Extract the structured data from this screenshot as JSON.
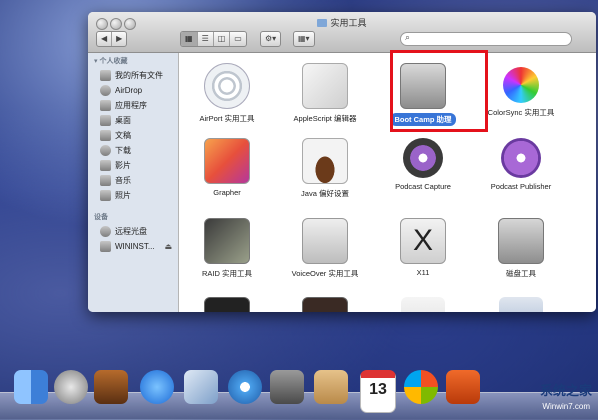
{
  "window": {
    "title": "实用工具",
    "nav": {
      "back": "◀",
      "forward": "▶"
    },
    "view_buttons": [
      "▦",
      "☰",
      "◫",
      "▭"
    ],
    "action_button": "⚙▾",
    "arrange_button": "▦▾",
    "search": {
      "icon": "search-icon",
      "placeholder": ""
    }
  },
  "sidebar": {
    "section_favorites": "个人收藏",
    "favorites": [
      {
        "label": "我的所有文件",
        "icon": "all-files-icon"
      },
      {
        "label": "AirDrop",
        "icon": "airdrop-icon"
      },
      {
        "label": "应用程序",
        "icon": "applications-icon"
      },
      {
        "label": "桌面",
        "icon": "desktop-icon"
      },
      {
        "label": "文稿",
        "icon": "documents-icon"
      },
      {
        "label": "下载",
        "icon": "downloads-icon"
      },
      {
        "label": "影片",
        "icon": "movies-icon"
      },
      {
        "label": "音乐",
        "icon": "music-icon"
      },
      {
        "label": "照片",
        "icon": "pictures-icon"
      }
    ],
    "section_devices": "设备",
    "devices": [
      {
        "label": "远程光盘",
        "icon": "remote-disc-icon"
      },
      {
        "label": "WININST...",
        "icon": "disk-icon",
        "eject": "⏏"
      }
    ]
  },
  "apps": [
    {
      "label": "AirPort 实用工具",
      "icon": "airport-utility-icon"
    },
    {
      "label": "AppleScript 编辑器",
      "icon": "applescript-editor-icon"
    },
    {
      "label": "Boot Camp 助理",
      "icon": "boot-camp-icon",
      "selected": true
    },
    {
      "label": "ColorSync 实用工具",
      "icon": "colorsync-icon"
    },
    {
      "label": "Grapher",
      "icon": "grapher-icon"
    },
    {
      "label": "Java 偏好设置",
      "icon": "java-icon"
    },
    {
      "label": "Podcast Capture",
      "icon": "podcast-capture-icon"
    },
    {
      "label": "Podcast Publisher",
      "icon": "podcast-publisher-icon"
    },
    {
      "label": "RAID 实用工具",
      "icon": "raid-utility-icon"
    },
    {
      "label": "VoiceOver 实用工具",
      "icon": "voiceover-icon"
    },
    {
      "label": "X11",
      "icon": "x11-icon"
    },
    {
      "label": "磁盘工具",
      "icon": "disk-utility-icon"
    }
  ],
  "dock": {
    "calendar_date": "13",
    "icons": [
      "finder-icon",
      "launchpad-icon",
      "dashboard-icon",
      "app-store-icon",
      "mail-icon",
      "safari-icon",
      "facetime-icon",
      "address-book-icon",
      "ical-icon",
      "windows-icon",
      "bootcamp-dock-icon"
    ]
  },
  "watermark": {
    "line1": "系统之家",
    "line2": "Winwin7.com"
  },
  "colors": {
    "selection": "#3875d7",
    "highlight_box": "#e4111b"
  }
}
